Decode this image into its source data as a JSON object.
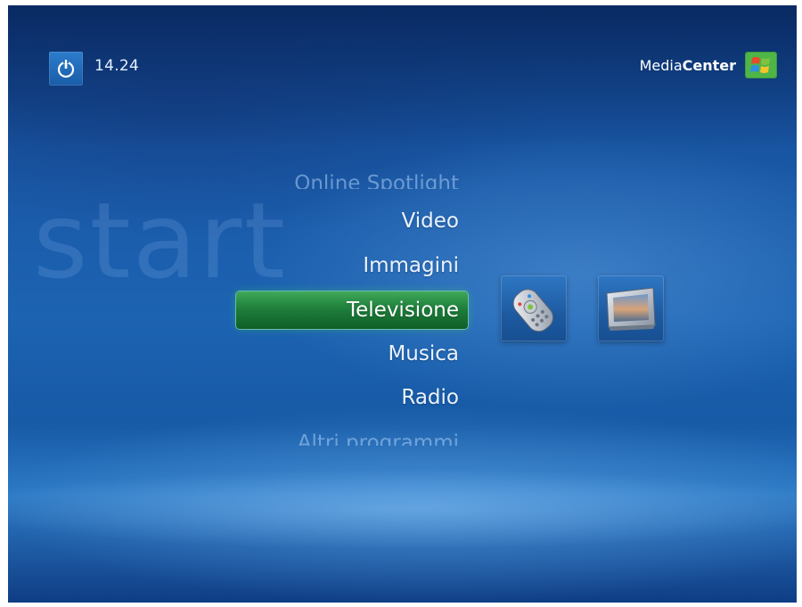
{
  "status": {
    "clock": "14.24",
    "power_icon": "power-icon"
  },
  "brand": {
    "prefix": "Media",
    "suffix": "Center",
    "logo_icon": "windows-flag-icon"
  },
  "section": {
    "watermark": "start"
  },
  "menu": {
    "items": [
      {
        "label": "Online Spotlight",
        "state": "faded"
      },
      {
        "label": "Video",
        "state": "normal"
      },
      {
        "label": "Immagini",
        "state": "normal"
      },
      {
        "label": "Televisione",
        "state": "selected"
      },
      {
        "label": "Musica",
        "state": "normal"
      },
      {
        "label": "Radio",
        "state": "normal"
      },
      {
        "label": "Altri programmi",
        "state": "faded"
      }
    ]
  },
  "tiles": [
    {
      "icon": "remote-control-icon"
    },
    {
      "icon": "tv-monitor-icon"
    }
  ],
  "colors": {
    "background": "#1c63b2",
    "selection": "#1f7f3b",
    "text": "#eaf2ff"
  }
}
